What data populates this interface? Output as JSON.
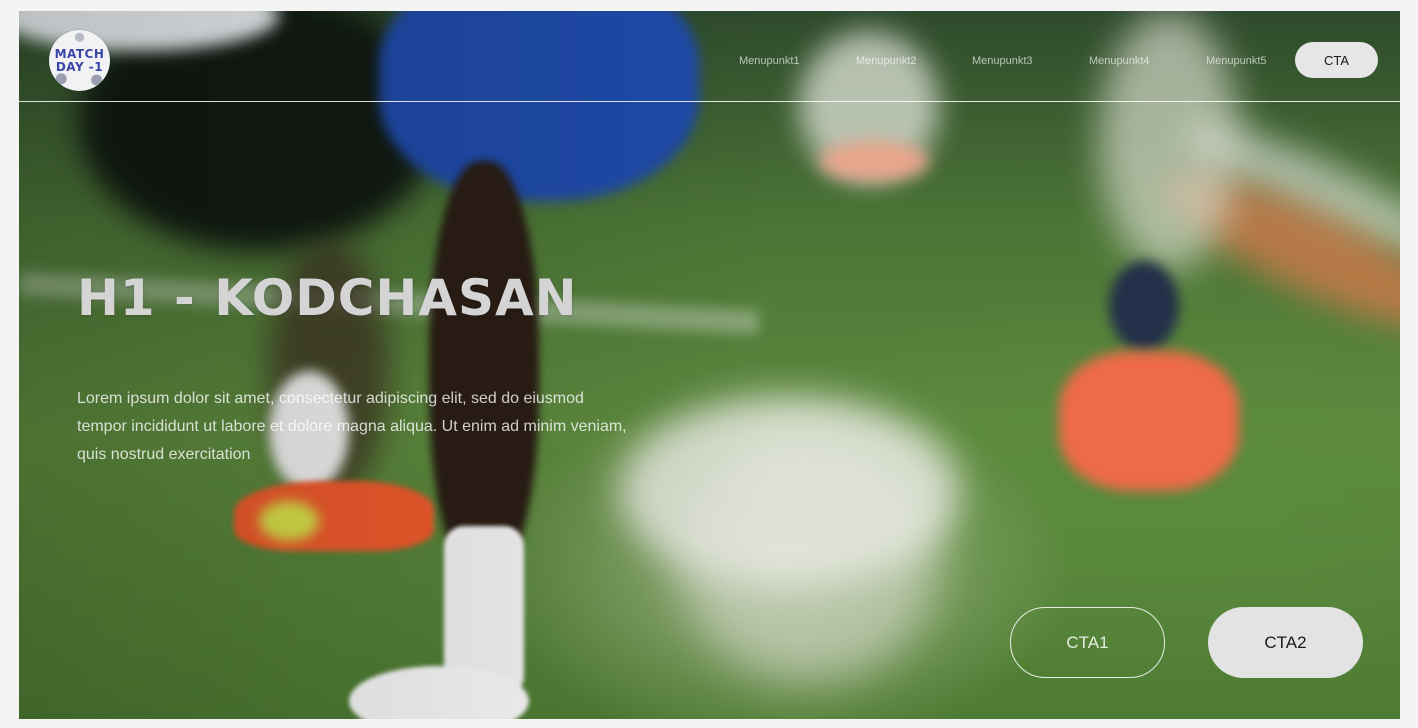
{
  "logo": {
    "line1": "MATCH",
    "line2": "DAY -1"
  },
  "nav": {
    "items": [
      {
        "label": "Menupunkt1"
      },
      {
        "label": "Menupunkt2"
      },
      {
        "label": "Menupunkt3"
      },
      {
        "label": "Menupunkt4"
      },
      {
        "label": "Menupunkt5"
      }
    ],
    "cta_label": "CTA"
  },
  "hero": {
    "heading": "H1 - KODCHASAN",
    "lead": "Lorem ipsum dolor sit amet, consectetur adipiscing elit, sed do eiusmod tempor incididunt ut labore et dolore magna aliqua. Ut enim ad minim veniam, quis nostrud exercitation",
    "cta1_label": "CTA1",
    "cta2_label": "CTA2"
  },
  "colors": {
    "page_bg": "#f4f4f4",
    "logo_text": "#3b47a8",
    "button_fill": "#e3e3e3",
    "heading": "#d4d4d4"
  }
}
